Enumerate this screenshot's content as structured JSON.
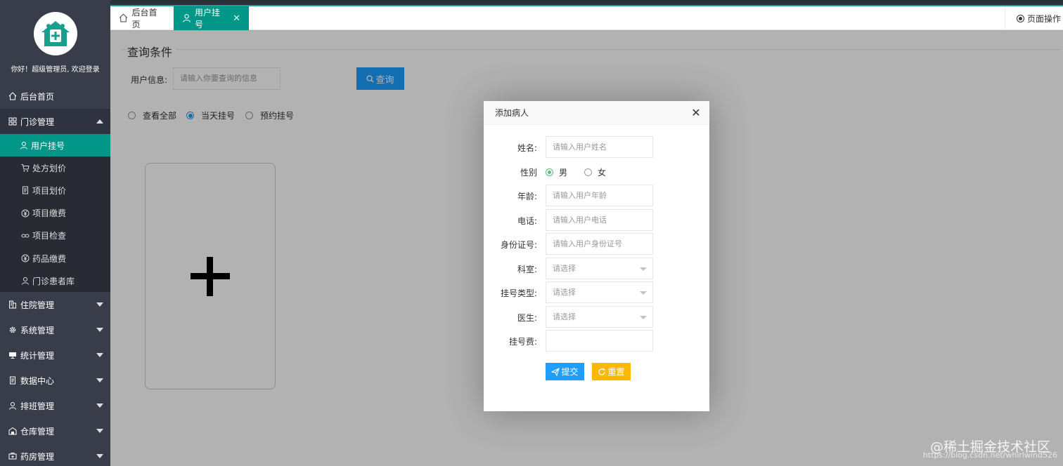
{
  "sidebar": {
    "greeting": "你好！超级管理员, 欢迎登录",
    "home": "后台首页",
    "groups": [
      {
        "label": "门诊管理",
        "icon": "apps-icon",
        "expanded": true
      },
      {
        "label": "住院管理",
        "icon": "building-icon"
      },
      {
        "label": "系统管理",
        "icon": "gear-icon"
      },
      {
        "label": "统计管理",
        "icon": "monitor-icon"
      },
      {
        "label": "数据中心",
        "icon": "document-icon"
      },
      {
        "label": "排班管理",
        "icon": "user-icon"
      },
      {
        "label": "仓库管理",
        "icon": "warehouse-icon"
      },
      {
        "label": "药房管理",
        "icon": "pharmacy-icon"
      }
    ],
    "outpatient_items": [
      "用户挂号",
      "处方划价",
      "项目划价",
      "项目缴费",
      "项目检查",
      "药品缴费",
      "门诊患者库"
    ]
  },
  "tabs": {
    "home": "后台首页",
    "registration": "用户挂号",
    "page_ops": "页面操作"
  },
  "query": {
    "title": "查询条件",
    "user_info_label": "用户信息:",
    "placeholder": "请输入你要查询的信息",
    "search_button": "查询",
    "filters": [
      "查看全部",
      "当天挂号",
      "预约挂号"
    ],
    "selected_filter": "当天挂号"
  },
  "modal": {
    "title": "添加病人",
    "name_label": "姓名:",
    "name_placeholder": "请输入用户姓名",
    "gender_label": "性别",
    "gender_options": [
      "男",
      "女"
    ],
    "gender_selected": "男",
    "age_label": "年龄:",
    "age_placeholder": "请输入用户年龄",
    "phone_label": "电话:",
    "phone_placeholder": "请输入用户电话",
    "id_label": "身份证号:",
    "id_placeholder": "请输入用户身份证号",
    "dept_label": "科室:",
    "dept_placeholder": "请选择",
    "type_label": "挂号类型:",
    "type_placeholder": "请选择",
    "doctor_label": "医生:",
    "doctor_placeholder": "请选择",
    "fee_label": "挂号费:",
    "fee_value": "",
    "submit": "提交",
    "reset": "重置"
  },
  "watermark": {
    "text": "@稀土掘金技术社区",
    "url": "https://blog.csdn.net/whirlwind526"
  },
  "colors": {
    "sidebar_bg": "#393d49",
    "accent_teal": "#009688",
    "primary_blue": "#1e9fff",
    "warning_yellow": "#ffb800"
  }
}
